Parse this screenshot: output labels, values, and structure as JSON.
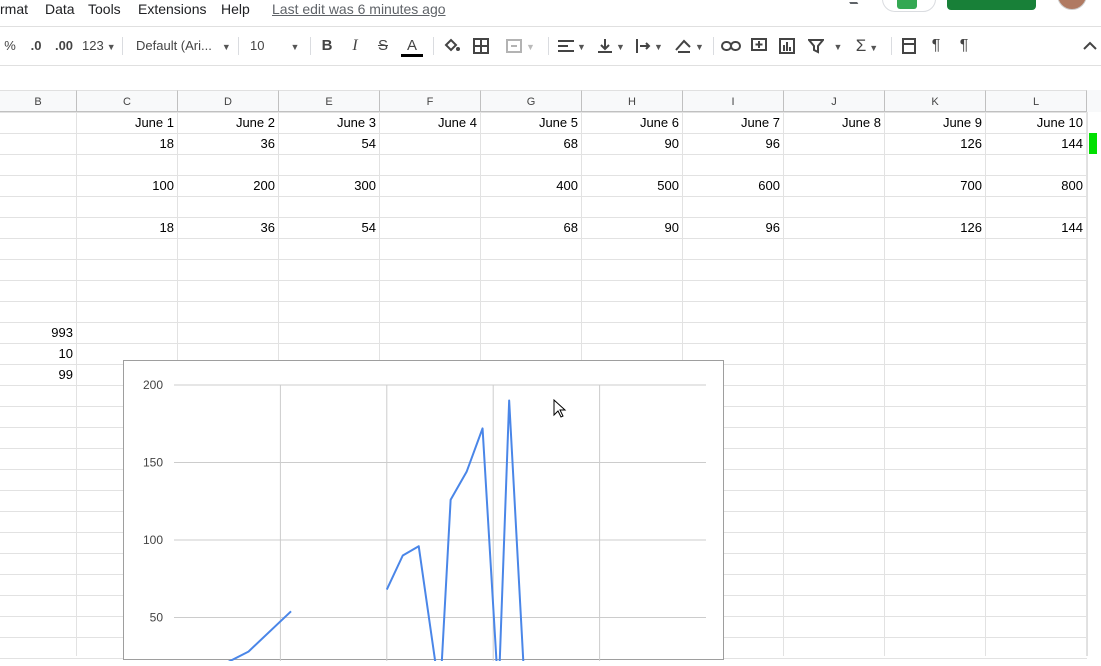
{
  "menubar": {
    "items": [
      "rmat",
      "Data",
      "Tools",
      "Extensions",
      "Help"
    ],
    "last_edit": "Last edit was 6 minutes ago"
  },
  "toolbar": {
    "percent": "%",
    "decrease_decimal": ".0",
    "increase_decimal": ".00",
    "more_formats": "123",
    "font_family": "Default (Ari...",
    "font_size": "10",
    "bold": "B",
    "italic": "I",
    "strikethrough": "S",
    "text_color": "A",
    "text_color_value": "#000000"
  },
  "columns": [
    "B",
    "C",
    "D",
    "E",
    "F",
    "G",
    "H",
    "I",
    "J",
    "K",
    "L"
  ],
  "sheet": {
    "row1": [
      "",
      "June 1",
      "June 2",
      "June 3",
      "June 4",
      "June 5",
      "June 6",
      "June 7",
      "June 8",
      "June 9",
      "June 10"
    ],
    "row2": [
      "",
      "18",
      "36",
      "54",
      "",
      "68",
      "90",
      "96",
      "",
      "126",
      "144"
    ],
    "row4": [
      "",
      "100",
      "200",
      "300",
      "",
      "400",
      "500",
      "600",
      "",
      "700",
      "800"
    ],
    "row6": [
      "",
      "18",
      "36",
      "54",
      "",
      "68",
      "90",
      "96",
      "",
      "126",
      "144"
    ],
    "b_values": [
      "993",
      "10",
      "99"
    ]
  },
  "chart_data": {
    "type": "line",
    "ylim": [
      0,
      200
    ],
    "yticks": [
      "200",
      "150",
      "100",
      "50"
    ],
    "series": [
      {
        "segments": [
          [
            [
              -0.6,
              0
            ],
            [
              0.2,
              28
            ],
            [
              0.6,
              54
            ]
          ],
          [
            [
              1.5,
              68
            ],
            [
              1.65,
              90
            ],
            [
              1.8,
              96
            ],
            [
              2.0,
              0
            ],
            [
              2.1,
              126
            ],
            [
              2.25,
              144
            ],
            [
              2.4,
              172
            ],
            [
              2.55,
              0
            ],
            [
              2.65,
              190
            ],
            [
              2.8,
              0
            ]
          ]
        ]
      }
    ],
    "xlim": [
      -0.5,
      4.5
    ],
    "line_color": "#4a86e8",
    "grid": true
  }
}
